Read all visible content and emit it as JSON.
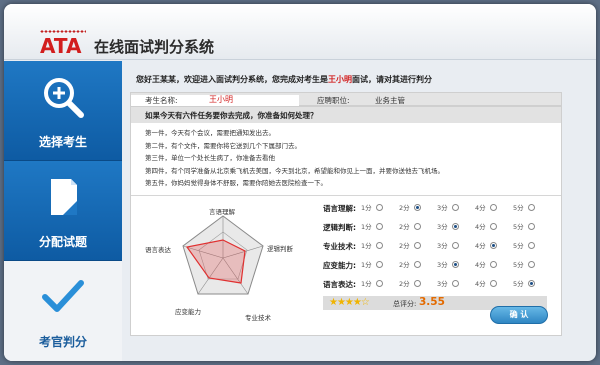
{
  "app": {
    "logo": "ATA",
    "title": "在线面试判分系统"
  },
  "sidebar": {
    "items": [
      {
        "label": "选择考生"
      },
      {
        "label": "分配试题"
      },
      {
        "label": "考官判分"
      }
    ]
  },
  "greeting": {
    "prefix": "您好王某某，欢迎进入面试判分系统，您完成对考生是",
    "candidate": "王小明",
    "suffix": "面试，请对其进行判分"
  },
  "info": {
    "name_label": "考生名称:",
    "name_value": "王小明",
    "position_label": "应聘职位:",
    "position_value": "业务主管"
  },
  "question": "如果今天有六件任务要你去完成，你准备如何处理？",
  "tasks": [
    "第一件，今天有个会议，需要把通知发出去。",
    "第二件，有个文件，需要你将它送到几个下属部门去。",
    "第三件，单位一个处长生病了，你准备去看他",
    "第四件，有个同学准备从北京乘飞机去美国，今天到北京，希望能和你见上一面，并要你送他去飞机场。",
    "第五件，你妈妈觉得身体不舒服，需要你陪她去医院检查一下。"
  ],
  "radar": {
    "axes": [
      "言语理解",
      "逻辑判断",
      "专业技术",
      "应变能力",
      "语言表达"
    ]
  },
  "ratings": {
    "option_labels": [
      "1分",
      "2分",
      "3分",
      "4分",
      "5分"
    ],
    "rows": [
      {
        "label": "语言理解:",
        "selected": 2
      },
      {
        "label": "逻辑判断:",
        "selected": 3
      },
      {
        "label": "专业技术:",
        "selected": 4
      },
      {
        "label": "应变能力:",
        "selected": 3
      },
      {
        "label": "语言表达:",
        "selected": 5
      }
    ]
  },
  "score": {
    "stars": "★★★★☆",
    "label": "总评分:",
    "value": "3.55"
  },
  "confirm_label": "确  认",
  "colors": {
    "accent": "#1f78c4",
    "brand_red": "#d21e1e",
    "score_orange": "#e36a00"
  }
}
